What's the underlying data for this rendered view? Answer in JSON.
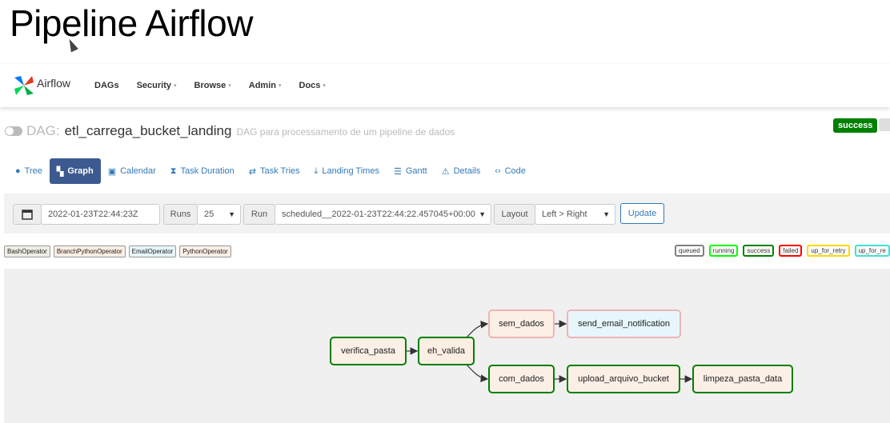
{
  "page_title": "Pipeline Airflow",
  "brand": {
    "name": "Airflow"
  },
  "nav": [
    {
      "label": "DAGs",
      "caret": false
    },
    {
      "label": "Security",
      "caret": true
    },
    {
      "label": "Browse",
      "caret": true
    },
    {
      "label": "Admin",
      "caret": true
    },
    {
      "label": "Docs",
      "caret": true
    }
  ],
  "dag": {
    "prefix": "DAG:",
    "name": "etl_carrega_bucket_landing",
    "description": "DAG para processamento de um pipeline de dados",
    "status": "success"
  },
  "tabs": [
    {
      "label": "Tree",
      "icon": "tree-icon",
      "glyph": "●"
    },
    {
      "label": "Graph",
      "icon": "graph-icon",
      "glyph": "▚",
      "active": true
    },
    {
      "label": "Calendar",
      "icon": "calendar-icon",
      "glyph": "▣"
    },
    {
      "label": "Task Duration",
      "icon": "hourglass-icon",
      "glyph": "⧗"
    },
    {
      "label": "Task Tries",
      "icon": "retry-icon",
      "glyph": "⇄"
    },
    {
      "label": "Landing Times",
      "icon": "landing-icon",
      "glyph": "⤓"
    },
    {
      "label": "Gantt",
      "icon": "gantt-icon",
      "glyph": "☰"
    },
    {
      "label": "Details",
      "icon": "details-icon",
      "glyph": "⚠"
    },
    {
      "label": "Code",
      "icon": "code-icon",
      "glyph": "‹›"
    }
  ],
  "form": {
    "base_date": "2022-01-23T22:44:23Z",
    "runs_label": "Runs",
    "runs_value": "25",
    "run_label": "Run",
    "run_value": "scheduled__2022-01-23T22:44:22.457045+00:00",
    "layout_label": "Layout",
    "layout_value": "Left > Right",
    "update_label": "Update"
  },
  "operators": [
    {
      "label": "BashOperator",
      "color": "#f0ede4"
    },
    {
      "label": "BranchPythonOperator",
      "color": "#fbeee3"
    },
    {
      "label": "EmailOperator",
      "color": "#e6f6fb"
    },
    {
      "label": "PythonOperator",
      "color": "#fbefe6"
    }
  ],
  "states": [
    {
      "label": "queued",
      "color": "#808080"
    },
    {
      "label": "running",
      "color": "#00ff00"
    },
    {
      "label": "success",
      "color": "#008000"
    },
    {
      "label": "failed",
      "color": "#ff0000"
    },
    {
      "label": "up_for_retry",
      "color": "#ffd700"
    },
    {
      "label": "up_for_re",
      "color": "#40e0d0"
    }
  ],
  "tasks": {
    "verifica_pasta": "verifica_pasta",
    "eh_valida": "eh_valida",
    "sem_dados": "sem_dados",
    "send_email_notification": "send_email_notification",
    "com_dados": "com_dados",
    "upload_arquivo_bucket": "upload_arquivo_bucket",
    "limpeza_pasta_data": "limpeza_pasta_data"
  }
}
